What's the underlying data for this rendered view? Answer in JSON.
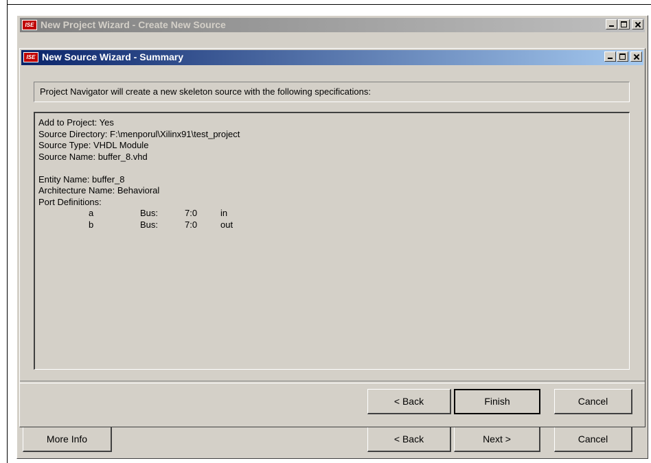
{
  "outer_window": {
    "title": "New Project Wizard - Create New Source",
    "icon_label": "ISE",
    "buttons": {
      "more_info": "More Info",
      "back": "< Back",
      "next": "Next >",
      "cancel": "Cancel"
    }
  },
  "inner_window": {
    "title": "New Source Wizard - Summary",
    "icon_label": "ISE",
    "header_text": "Project Navigator will create a new skeleton source with the following specifications:",
    "summary": {
      "add_to_project": "Add to Project: Yes",
      "source_directory": "Source Directory: F:\\menporul\\Xilinx91\\test_project",
      "source_type": "Source Type: VHDL Module",
      "source_name": "Source Name: buffer_8.vhd",
      "entity_name": "Entity Name: buffer_8",
      "architecture_name": "Architecture Name: Behavioral",
      "port_definitions_label": "Port Definitions:",
      "ports": [
        {
          "name": "a",
          "type": "Bus:",
          "range": "7:0",
          "direction": "in"
        },
        {
          "name": "b",
          "type": "Bus:",
          "range": "7:0",
          "direction": "out"
        }
      ]
    },
    "buttons": {
      "back": "< Back",
      "finish": "Finish",
      "cancel": "Cancel"
    }
  }
}
